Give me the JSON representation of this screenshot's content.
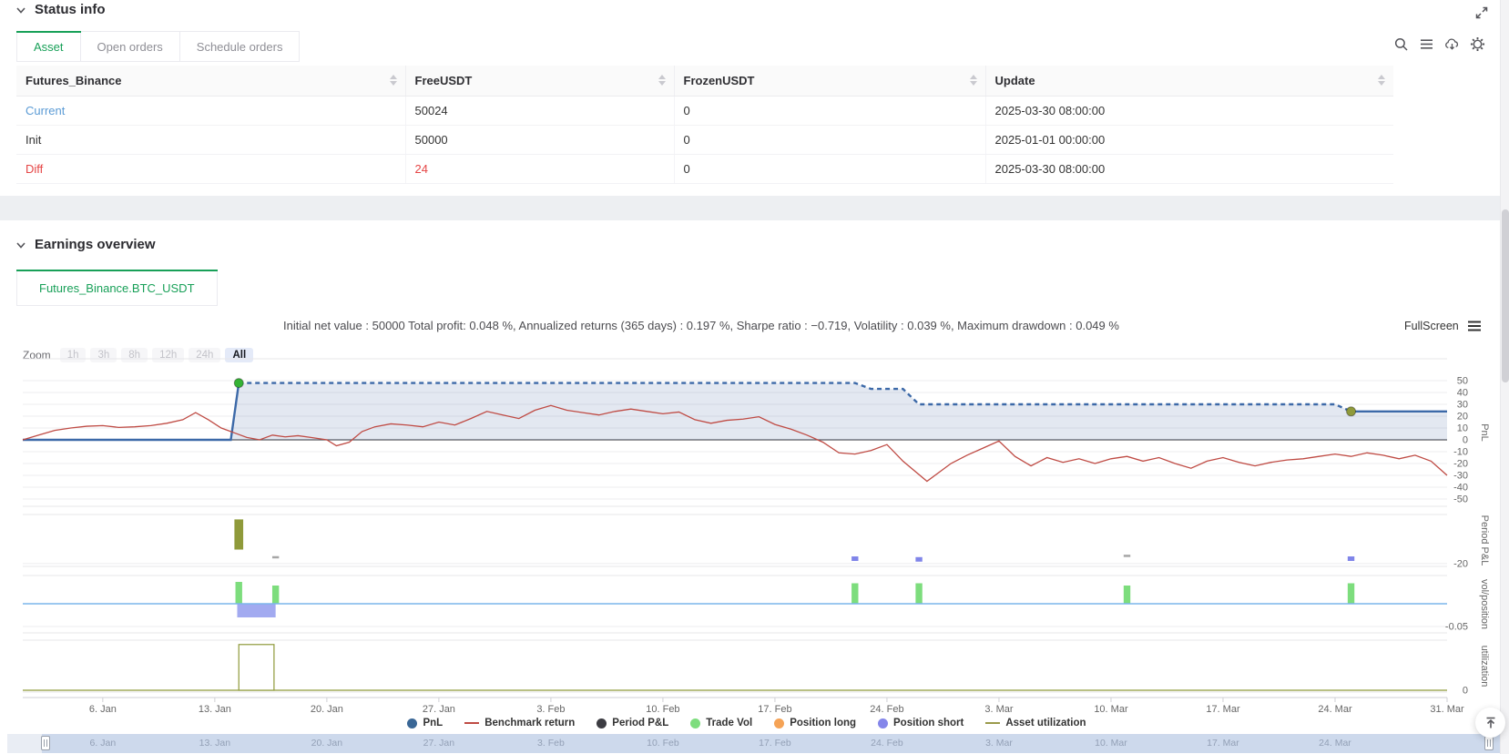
{
  "status_info": {
    "title": "Status info",
    "tabs": [
      {
        "label": "Asset",
        "active": true
      },
      {
        "label": "Open orders",
        "active": false
      },
      {
        "label": "Schedule orders",
        "active": false
      }
    ],
    "toolbar_icons": [
      "search-icon",
      "menu-icon",
      "cloud-download-icon",
      "gear-icon"
    ],
    "header_icon": "expand-icon",
    "table": {
      "columns": [
        "Futures_Binance",
        "FreeUSDT",
        "FrozenUSDT",
        "Update"
      ],
      "rows": [
        {
          "label": "Current",
          "label_color": "#5b9bd5",
          "free": "50024",
          "frozen": "0",
          "update": "2025-03-30 08:00:00"
        },
        {
          "label": "Init",
          "free": "50000",
          "frozen": "0",
          "update": "2025-01-01 00:00:00"
        },
        {
          "label": "Diff",
          "label_color": "#e54545",
          "free": "24",
          "free_color": "#e54545",
          "frozen": "0",
          "update": "2025-03-30 08:00:00"
        }
      ]
    }
  },
  "earnings": {
    "title": "Earnings overview",
    "tab": "Futures_Binance.BTC_USDT",
    "stats": "Initial net value : 50000 Total profit: 0.048 %, Annualized returns (365 days) : 0.197 %, Sharpe ratio : −0.719, Volatility : 0.039 %, Maximum drawdown : 0.049 %",
    "fullscreen_label": "FullScreen",
    "zoom": {
      "label": "Zoom",
      "buttons": [
        "1h",
        "3h",
        "8h",
        "12h",
        "24h",
        "All"
      ],
      "active": "All"
    }
  },
  "chart_data": {
    "type": "line",
    "description": "Multi-panel stock chart: PnL vs benchmark return, period P&L bars, trade volume / position bars, asset utilization",
    "x_unit": "days since 2025-01-01",
    "x_days_range": [
      0,
      89
    ],
    "x_ticks": [
      {
        "day": 5,
        "label": "6. Jan"
      },
      {
        "day": 12,
        "label": "13. Jan"
      },
      {
        "day": 19,
        "label": "20. Jan"
      },
      {
        "day": 26,
        "label": "27. Jan"
      },
      {
        "day": 33,
        "label": "3. Feb"
      },
      {
        "day": 40,
        "label": "10. Feb"
      },
      {
        "day": 47,
        "label": "17. Feb"
      },
      {
        "day": 54,
        "label": "24. Feb"
      },
      {
        "day": 61,
        "label": "3. Mar"
      },
      {
        "day": 68,
        "label": "10. Mar"
      },
      {
        "day": 75,
        "label": "17. Mar"
      },
      {
        "day": 82,
        "label": "24. Mar"
      },
      {
        "day": 89,
        "label": "31. Mar"
      }
    ],
    "panels": [
      {
        "name": "pnl",
        "axis_title": "PnL",
        "yticks": [
          50,
          40,
          30,
          20,
          10,
          0,
          -10,
          -20,
          -30,
          -40,
          -50
        ],
        "series": [
          {
            "name": "PnL",
            "type": "line",
            "color": "#3c69a8",
            "width": 2.4,
            "area_fill": "rgba(98,130,180,0.18)",
            "dashed_between_days": [
              13.5,
              83
            ],
            "points": [
              [
                0,
                0
              ],
              [
                13,
                0
              ],
              [
                13.5,
                48
              ],
              [
                52,
                48
              ],
              [
                53,
                43
              ],
              [
                55,
                43
              ],
              [
                56,
                30
              ],
              [
                82,
                30
              ],
              [
                83,
                24
              ],
              [
                89,
                24
              ]
            ],
            "markers": [
              {
                "day": 13.5,
                "value": 48,
                "color": "#35b235",
                "name": "position-open-marker"
              },
              {
                "day": 83,
                "value": 24,
                "color": "#8f9a3a",
                "name": "position-close-marker"
              }
            ]
          },
          {
            "name": "Benchmark return",
            "type": "line",
            "color": "#bf4b44",
            "width": 1.3,
            "points": [
              [
                0,
                0
              ],
              [
                1,
                4
              ],
              [
                2,
                8
              ],
              [
                3,
                10
              ],
              [
                4,
                11.5
              ],
              [
                5,
                12
              ],
              [
                6,
                10.5
              ],
              [
                7,
                11
              ],
              [
                8,
                12
              ],
              [
                9,
                14
              ],
              [
                10,
                17
              ],
              [
                10.8,
                23
              ],
              [
                11.6,
                17
              ],
              [
                12.4,
                10
              ],
              [
                13.2,
                6
              ],
              [
                14,
                2
              ],
              [
                14.8,
                0
              ],
              [
                15.6,
                4
              ],
              [
                16.4,
                2.5
              ],
              [
                17.2,
                3.5
              ],
              [
                18,
                2
              ],
              [
                19,
                0
              ],
              [
                19.6,
                -5
              ],
              [
                20.4,
                -2
              ],
              [
                21.2,
                7
              ],
              [
                22,
                11
              ],
              [
                23,
                13.5
              ],
              [
                24,
                12.5
              ],
              [
                25,
                11
              ],
              [
                26,
                15
              ],
              [
                27,
                12.5
              ],
              [
                28,
                18
              ],
              [
                29,
                24
              ],
              [
                30,
                21
              ],
              [
                31,
                18
              ],
              [
                32,
                25
              ],
              [
                33,
                29
              ],
              [
                34,
                25
              ],
              [
                35,
                23
              ],
              [
                36,
                21
              ],
              [
                37,
                24
              ],
              [
                38,
                26
              ],
              [
                39,
                24
              ],
              [
                40,
                22
              ],
              [
                41,
                23.5
              ],
              [
                42,
                17
              ],
              [
                43,
                14
              ],
              [
                44,
                16.5
              ],
              [
                45,
                17.5
              ],
              [
                46,
                19.5
              ],
              [
                47,
                13
              ],
              [
                48,
                9
              ],
              [
                49,
                4
              ],
              [
                50,
                -2
              ],
              [
                51,
                -11
              ],
              [
                52,
                -12
              ],
              [
                53,
                -9
              ],
              [
                54,
                -4
              ],
              [
                55,
                -18
              ],
              [
                56.5,
                -35
              ],
              [
                58,
                -20
              ],
              [
                59,
                -13
              ],
              [
                60,
                -7
              ],
              [
                61,
                -1
              ],
              [
                62,
                -14
              ],
              [
                63,
                -22
              ],
              [
                64,
                -15
              ],
              [
                65,
                -19
              ],
              [
                66,
                -16
              ],
              [
                67,
                -20
              ],
              [
                68,
                -16
              ],
              [
                69,
                -14
              ],
              [
                70,
                -18
              ],
              [
                71,
                -15
              ],
              [
                72,
                -20
              ],
              [
                73,
                -24
              ],
              [
                74,
                -18
              ],
              [
                75,
                -15
              ],
              [
                76,
                -19
              ],
              [
                77,
                -22
              ],
              [
                78,
                -19
              ],
              [
                79,
                -17
              ],
              [
                80,
                -16
              ],
              [
                81,
                -14
              ],
              [
                82,
                -12
              ],
              [
                83,
                -14
              ],
              [
                84,
                -11
              ],
              [
                85,
                -13
              ],
              [
                86,
                -16
              ],
              [
                87,
                -13
              ],
              [
                88,
                -18
              ],
              [
                89,
                -30
              ]
            ]
          }
        ]
      },
      {
        "name": "period-pnl",
        "axis_title": "Period P&L",
        "yticks": [
          -20
        ],
        "series": [
          {
            "name": "Period P&L",
            "type": "bar",
            "bars": [
              {
                "day": 13.5,
                "value": 43,
                "color": "#8f9a3a",
                "width_days": 0.55
              },
              {
                "day": 15.8,
                "value": -11,
                "color": "#a6a6a6",
                "style": "dash"
              },
              {
                "day": 52,
                "value": -13,
                "color": "#8085e9",
                "style": "thick-dash"
              },
              {
                "day": 56,
                "value": -14,
                "color": "#8085e9",
                "style": "thick-dash"
              },
              {
                "day": 69,
                "value": -9,
                "color": "#a6a6a6",
                "style": "dash"
              },
              {
                "day": 83,
                "value": -13,
                "color": "#8085e9",
                "style": "thick-dash"
              }
            ]
          }
        ]
      },
      {
        "name": "vol-position",
        "axis_title": "vol/position",
        "yticks": [
          -0.05
        ],
        "series": [
          {
            "name": "Trade Vol",
            "type": "bar",
            "color": "#7ddd7d",
            "bars": [
              {
                "day": 13.5,
                "value": 0.048
              },
              {
                "day": 15.8,
                "value": 0.04
              },
              {
                "day": 52,
                "value": 0.045
              },
              {
                "day": 56,
                "value": 0.045
              },
              {
                "day": 69,
                "value": 0.04
              },
              {
                "day": 83,
                "value": 0.045
              }
            ]
          },
          {
            "name": "Position short",
            "type": "bar",
            "color": "#a2aaf0",
            "bars": [
              {
                "day": 14.6,
                "value": -0.03,
                "width_days": 2.4
              }
            ]
          },
          {
            "name": "Position",
            "type": "line",
            "color": "#7cb5ec",
            "width": 1.6,
            "points": [
              [
                0,
                0
              ],
              [
                89,
                0
              ]
            ]
          }
        ]
      },
      {
        "name": "utilization",
        "axis_title": "utilization",
        "yticks": [
          0
        ],
        "series": [
          {
            "name": "Asset utilization",
            "type": "outline-bar",
            "color": "#8f9a3a",
            "baseline": true,
            "bars": [
              {
                "day": 14.6,
                "value": 0.93,
                "width_days": 2.2
              }
            ]
          }
        ]
      }
    ],
    "legend": [
      {
        "label": "PnL",
        "marker": "circle",
        "color": "#3a6796"
      },
      {
        "label": "Benchmark return",
        "marker": "line",
        "color": "#bf4b44"
      },
      {
        "label": "Period P&L",
        "marker": "circle",
        "color": "#3c3c42"
      },
      {
        "label": "Trade Vol",
        "marker": "circle",
        "color": "#7ddd7d"
      },
      {
        "label": "Position long",
        "marker": "circle",
        "color": "#f5a356"
      },
      {
        "label": "Position short",
        "marker": "circle",
        "color": "#8486ea"
      },
      {
        "label": "Asset utilization",
        "marker": "line",
        "color": "#9a9a4a"
      }
    ],
    "navigator_labels": [
      "6. Jan",
      "13. Jan",
      "20. Jan",
      "27. Jan",
      "3. Feb",
      "10. Feb",
      "17. Feb",
      "24. Feb",
      "3. Mar",
      "10. Mar",
      "17. Mar",
      "24. Mar"
    ]
  }
}
